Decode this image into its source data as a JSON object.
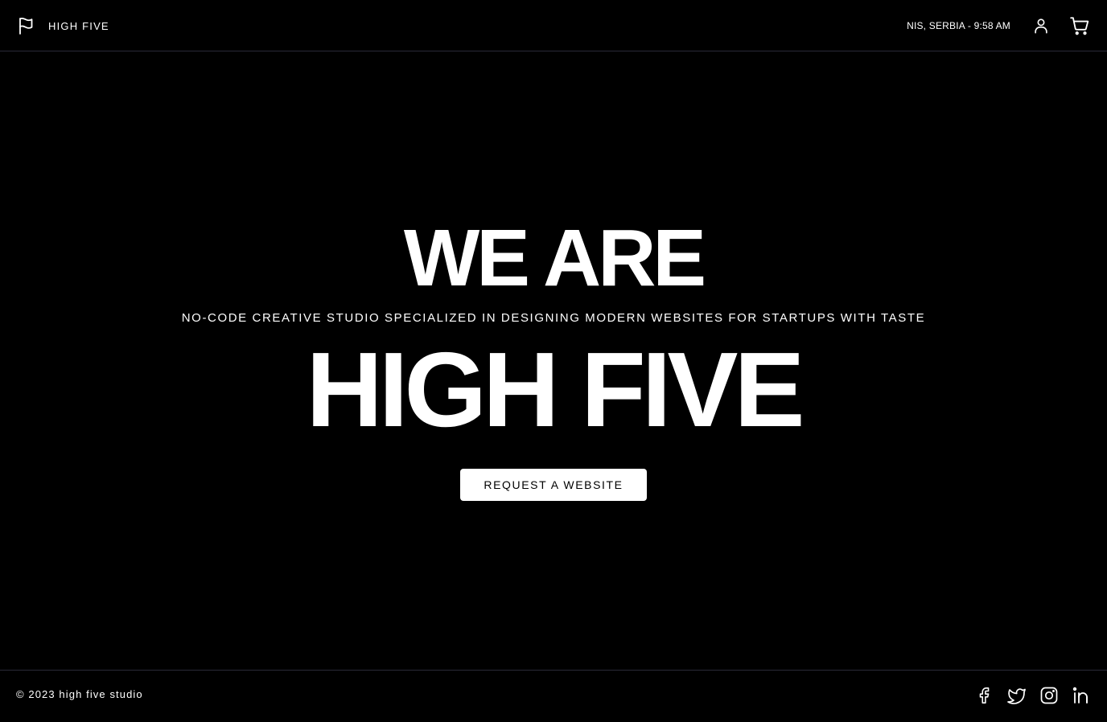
{
  "header": {
    "brand_label": "HIGH FIVE",
    "location_time": "NIS, SERBIA - 9:58 AM",
    "icons": {
      "logo": "flag-icon",
      "account": "user-icon",
      "cart": "cart-icon"
    }
  },
  "hero": {
    "headline_top": "WE ARE",
    "tagline": "NO-CODE CREATIVE STUDIO SPECIALIZED IN DESIGNING MODERN WEBSITES FOR STARTUPS WITH TASTE",
    "headline_main": "HIGH FIVE",
    "cta_label": "REQUEST A WEBSITE"
  },
  "footer": {
    "copyright": "© 2023 high five studio",
    "social_icons": [
      "facebook-icon",
      "twitter-icon",
      "instagram-icon",
      "linkedin-icon"
    ]
  },
  "colors": {
    "background": "#000000",
    "text": "#ffffff",
    "divider": "#2a2a38",
    "button_bg": "#ffffff",
    "button_text": "#000000"
  }
}
